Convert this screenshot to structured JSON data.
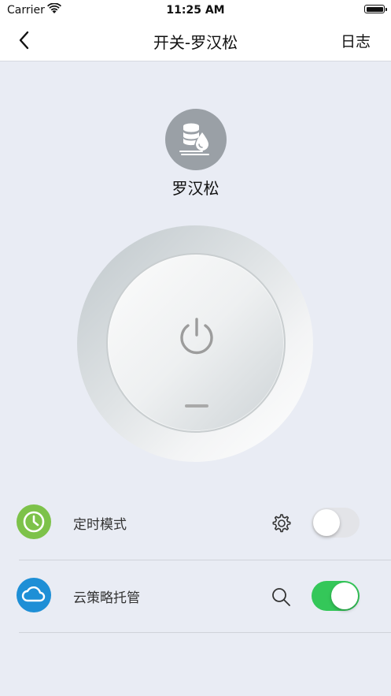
{
  "status_bar": {
    "carrier": "Carrier",
    "time": "11:25 AM"
  },
  "nav": {
    "title": "开关-罗汉松",
    "log_label": "日志",
    "back_icon": "chevron-left-icon"
  },
  "device": {
    "name": "罗汉松",
    "icon": "irrigation-device-icon",
    "power_icon": "power-icon"
  },
  "rows": [
    {
      "label": "定时模式",
      "icon": "clock-icon",
      "icon_color": "#7dc24a",
      "action_icon": "gear-icon",
      "toggle_on": false
    },
    {
      "label": "云策略托管",
      "icon": "cloud-icon",
      "icon_color": "#1e8fd6",
      "action_icon": "search-icon",
      "toggle_on": true
    }
  ],
  "colors": {
    "toggle_on": "#34c759",
    "toggle_off": "#e3e4e8"
  }
}
